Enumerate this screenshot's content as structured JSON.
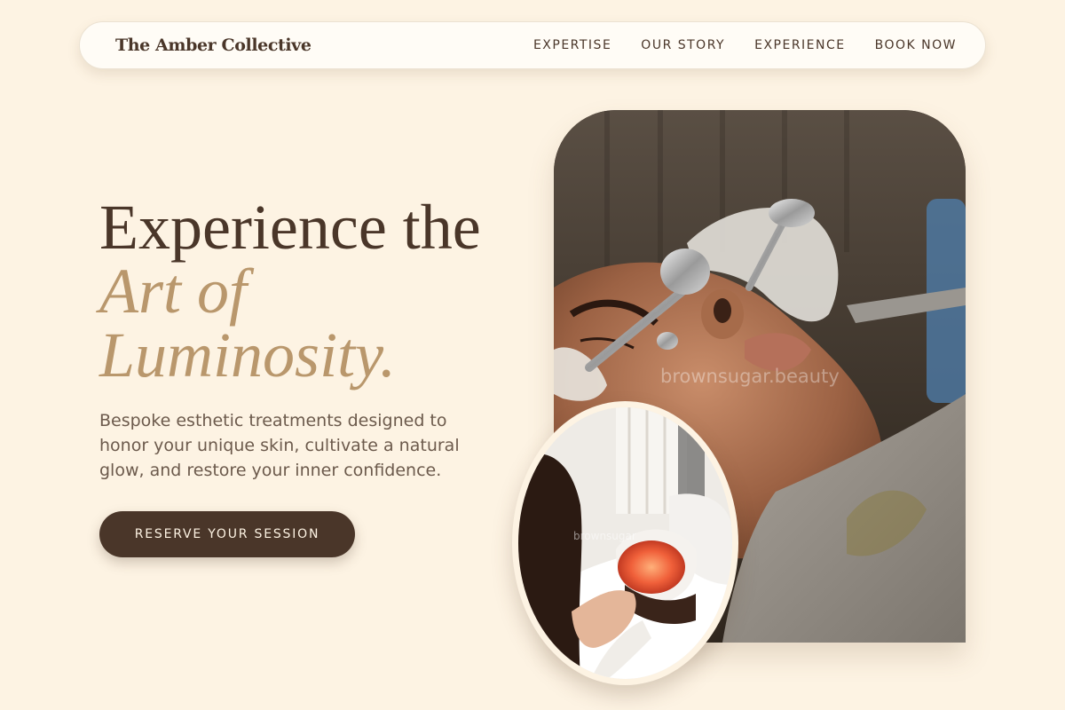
{
  "brand": {
    "name": "The Amber Collective"
  },
  "nav": {
    "links": [
      "EXPERTISE",
      "OUR STORY",
      "EXPERIENCE",
      "BOOK NOW"
    ]
  },
  "hero": {
    "title_line1": "Experience the",
    "title_accent_line1": "Art of",
    "title_accent_line2": "Luminosity.",
    "subtitle": "Bespoke esthetic treatments designed to honor your unique skin, cultivate a natural glow, and restore your inner confidence.",
    "cta_label": "RESERVE YOUR SESSION"
  },
  "images": {
    "main_watermark": "brownsugar.beauty",
    "oval_watermark": "brownsugar"
  },
  "colors": {
    "background": "#fdf3e3",
    "primary": "#4a3629",
    "accent": "#b9976c",
    "body_text": "#6c5a4c",
    "nav_surface": "#fffcf6"
  }
}
